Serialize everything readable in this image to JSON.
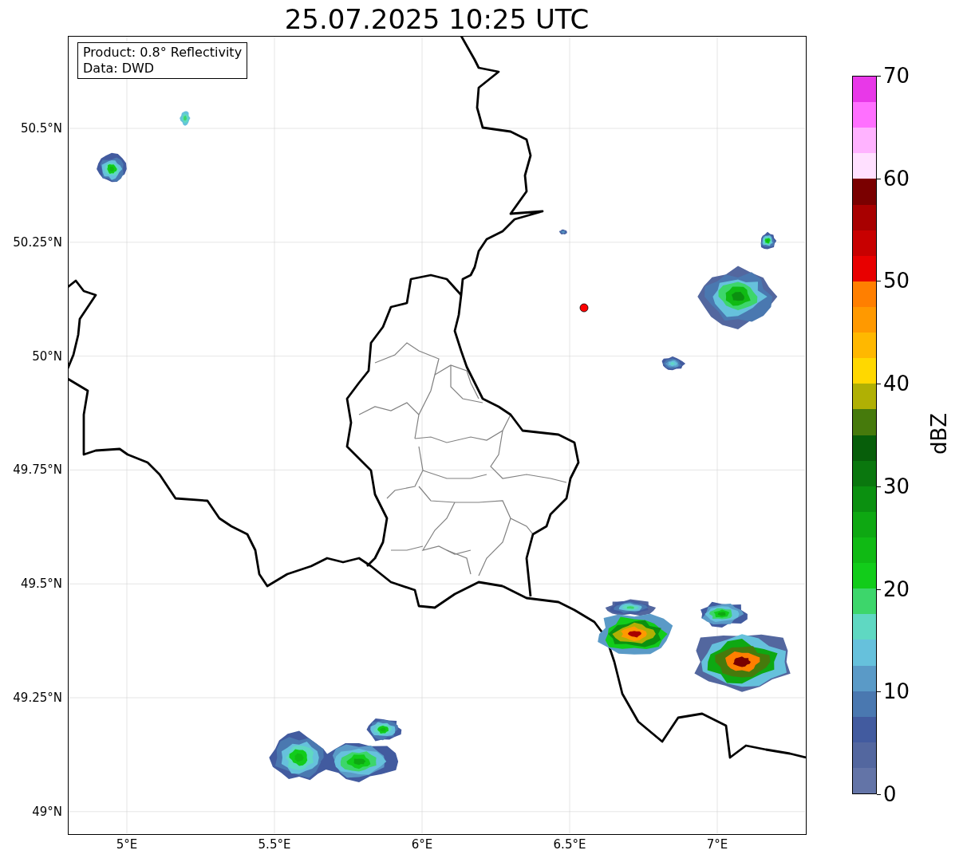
{
  "title": "25.07.2025 10:25 UTC",
  "info_box": [
    "Product: 0.8° Reflectivity",
    "Data: DWD"
  ],
  "map": {
    "xticks": [
      "5°E",
      "5.5°E",
      "6°E",
      "6.5°E",
      "7°E"
    ],
    "yticks": [
      "50.5°N",
      "50.25°N",
      "50°N",
      "49.75°N",
      "49.5°N",
      "49.25°N",
      "49°N"
    ]
  },
  "colorbar": {
    "label": "dBZ",
    "ticks": [
      "70",
      "60",
      "50",
      "40",
      "30",
      "20",
      "10",
      "0"
    ],
    "bins": [
      {
        "color": "#e838e8"
      },
      {
        "color": "#ff70ff"
      },
      {
        "color": "#ffb3ff"
      },
      {
        "color": "#ffe0ff"
      },
      {
        "color": "#7a0000"
      },
      {
        "color": "#a80000"
      },
      {
        "color": "#c80000"
      },
      {
        "color": "#e80000"
      },
      {
        "color": "#ff7f00"
      },
      {
        "color": "#ff9900"
      },
      {
        "color": "#ffb800"
      },
      {
        "color": "#ffd800"
      },
      {
        "color": "#b0b004"
      },
      {
        "color": "#467a0c"
      },
      {
        "color": "#075e0a"
      },
      {
        "color": "#0a770e"
      },
      {
        "color": "#0b9010"
      },
      {
        "color": "#0ea812"
      },
      {
        "color": "#10ba14"
      },
      {
        "color": "#12cc1a"
      },
      {
        "color": "#3dd66b"
      },
      {
        "color": "#5fd8c2"
      },
      {
        "color": "#66c1dc"
      },
      {
        "color": "#5a9ac7"
      },
      {
        "color": "#4a78b0"
      },
      {
        "color": "#425b9f"
      },
      {
        "color": "#53679f"
      },
      {
        "color": "#6374a7"
      }
    ]
  }
}
